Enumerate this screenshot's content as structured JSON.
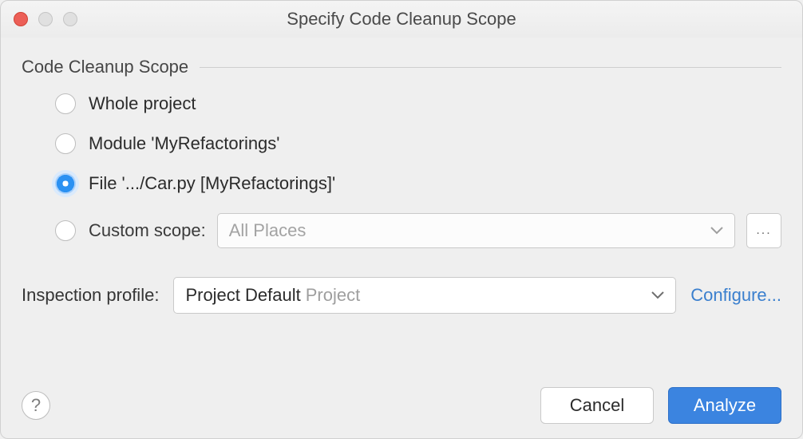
{
  "window": {
    "title": "Specify Code Cleanup Scope"
  },
  "group": {
    "title": "Code Cleanup Scope"
  },
  "options": {
    "whole_project": {
      "label": "Whole project"
    },
    "module": {
      "label": "Module 'MyRefactorings'"
    },
    "file": {
      "label": "File '.../Car.py [MyRefactorings]'"
    },
    "custom": {
      "label": "Custom scope:"
    },
    "selected": "file"
  },
  "custom_scope": {
    "selected": "All Places",
    "ellipsis": "..."
  },
  "inspection": {
    "label": "Inspection profile:",
    "profile_primary": "Project Default",
    "profile_secondary": "Project",
    "configure": "Configure..."
  },
  "footer": {
    "help": "?",
    "cancel": "Cancel",
    "analyze": "Analyze"
  }
}
